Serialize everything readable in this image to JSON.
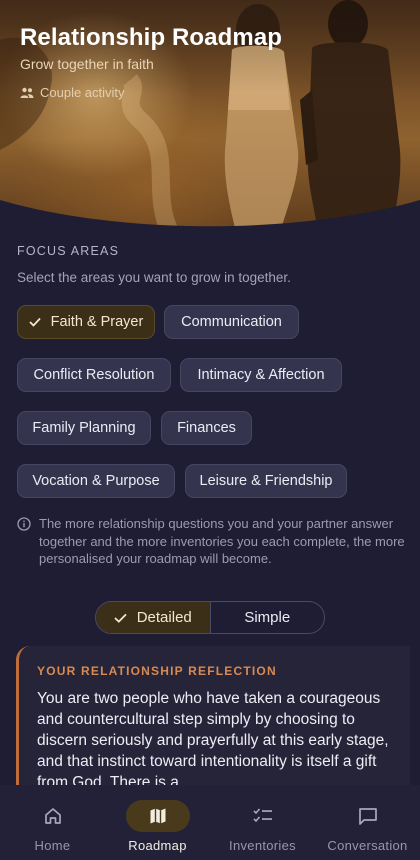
{
  "hero": {
    "title": "Relationship Roadmap",
    "subtitle": "Grow together in faith",
    "tag_icon": "people-icon",
    "tag": "Couple activity"
  },
  "focus": {
    "label": "FOCUS AREAS",
    "description": "Select the areas you want to grow in together.",
    "chips": [
      {
        "label": "Faith & Prayer",
        "selected": true
      },
      {
        "label": "Communication",
        "selected": false
      },
      {
        "label": "Conflict Resolution",
        "selected": false
      },
      {
        "label": "Intimacy & Affection",
        "selected": false
      },
      {
        "label": "Family Planning",
        "selected": false
      },
      {
        "label": "Finances",
        "selected": false
      },
      {
        "label": "Vocation & Purpose",
        "selected": false
      },
      {
        "label": "Leisure & Friendship",
        "selected": false
      }
    ]
  },
  "info": {
    "icon": "info-icon",
    "text": "The more relationship questions you and your partner answer together and the more inventories you each complete, the more personalised your roadmap will become."
  },
  "view_toggle": {
    "options": [
      {
        "label": "Detailed",
        "active": true
      },
      {
        "label": "Simple",
        "active": false
      }
    ]
  },
  "reflection": {
    "label": "YOUR RELATIONSHIP REFLECTION",
    "body": "You are two people who have taken a courageous and countercultural step simply by choosing to discern seriously and prayerfully at this early stage, and that instinct toward intentionality is itself a gift from God. There is a"
  },
  "nav": {
    "items": [
      {
        "label": "Home",
        "icon": "home-icon",
        "active": false
      },
      {
        "label": "Roadmap",
        "icon": "map-icon",
        "active": true
      },
      {
        "label": "Inventories",
        "icon": "checklist-icon",
        "active": false
      },
      {
        "label": "Conversation",
        "icon": "chat-icon",
        "active": false
      }
    ]
  },
  "colors": {
    "background": "#1f1d33",
    "accent": "#3b2f17",
    "reflection_accent": "#c06d3c"
  }
}
